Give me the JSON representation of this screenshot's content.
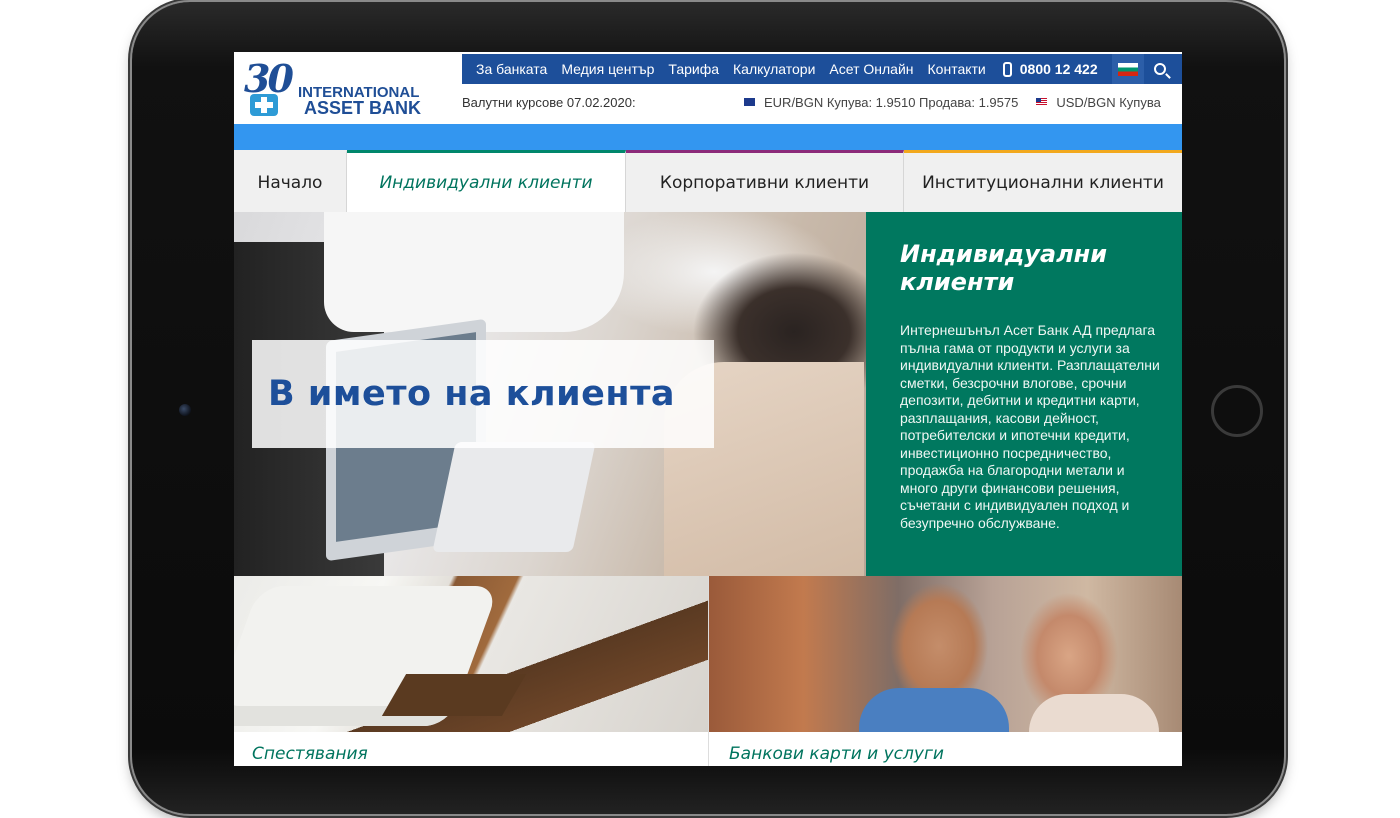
{
  "logo": {
    "anniversary": "30",
    "line1": "INTERNATIONAL",
    "line2": "ASSET BANK"
  },
  "topnav": {
    "links": [
      "За банката",
      "Медия център",
      "Тарифа",
      "Калкулатори",
      "Асет Онлайн",
      "Контакти"
    ],
    "phone": "0800 12 422"
  },
  "rates": {
    "title": "Валутни курсове 07.02.2020:",
    "items": [
      "EUR/BGN Купува: 1.9510 Продава: 1.9575",
      "USD/BGN Купува"
    ]
  },
  "mainnav": {
    "items": [
      "Начало",
      "Индивидуални клиенти",
      "Корпоративни клиенти",
      "Институционални клиенти"
    ]
  },
  "hero": {
    "caption": "В името на клиента"
  },
  "info": {
    "title_line1": "Индивидуални",
    "title_line2": "клиенти",
    "text": "Интернешънъл Асет Банк АД предлага пълна гама от продукти и услуги за индивидуални клиенти. Разплащателни сметки, безсрочни влогове, срочни депозити, дебитни и кредитни карти, разплащания, касови дейност, потребителски и ипотечни кредити, инвестиционно посредничество, продажба на благородни метали и много други финансови решения, съчетани с индивидуален подход и безупречно обслужване."
  },
  "cards": [
    {
      "title": "Спестявания"
    },
    {
      "title": "Банкови карти и услуги"
    }
  ],
  "colors": {
    "brand_blue": "#1d4f9a",
    "accent_green": "#00785f",
    "strip_blue": "#3396f0"
  }
}
